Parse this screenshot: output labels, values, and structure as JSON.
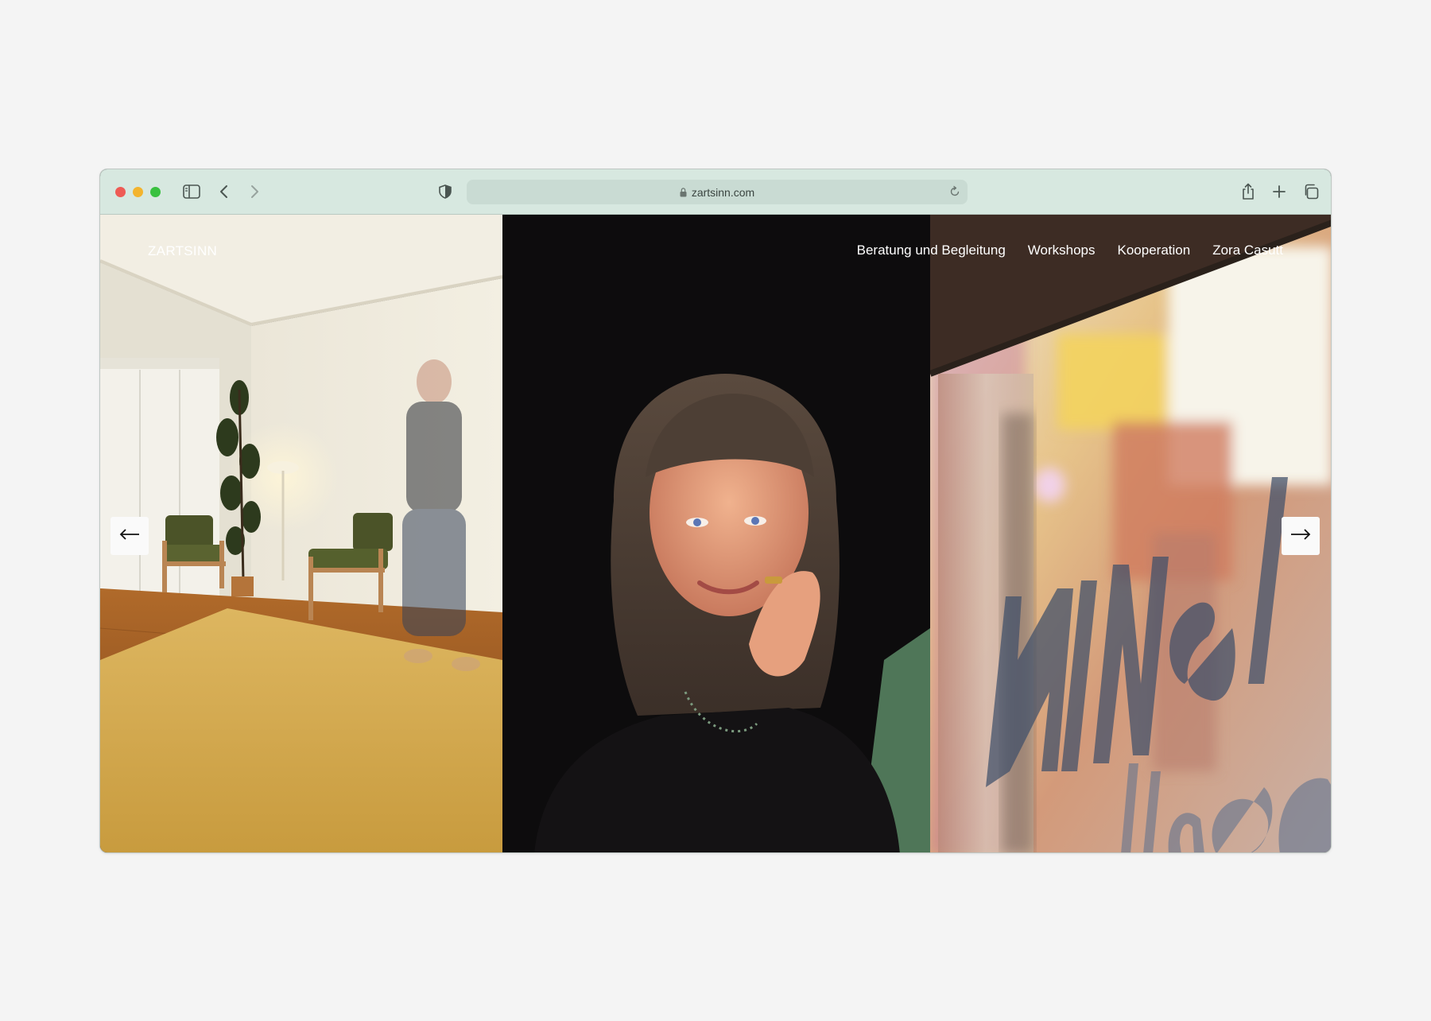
{
  "browser": {
    "url": "zartsinn.com"
  },
  "site": {
    "logo": "ZARTSINN",
    "nav": [
      {
        "label": "Beratung und Begleitung"
      },
      {
        "label": "Workshops"
      },
      {
        "label": "Kooperation"
      },
      {
        "label": "Zora Casutt"
      }
    ]
  },
  "slider": {
    "prev_icon": "arrow-left-icon",
    "next_icon": "arrow-right-icon",
    "slides": [
      {
        "subject": "room-photo"
      },
      {
        "subject": "portrait-photo"
      },
      {
        "subject": "window-photo"
      }
    ]
  },
  "colors": {
    "toolbar": "#d7e8e0",
    "address_bar": "#c9dbd3",
    "page_background": "#f4f4f4"
  }
}
